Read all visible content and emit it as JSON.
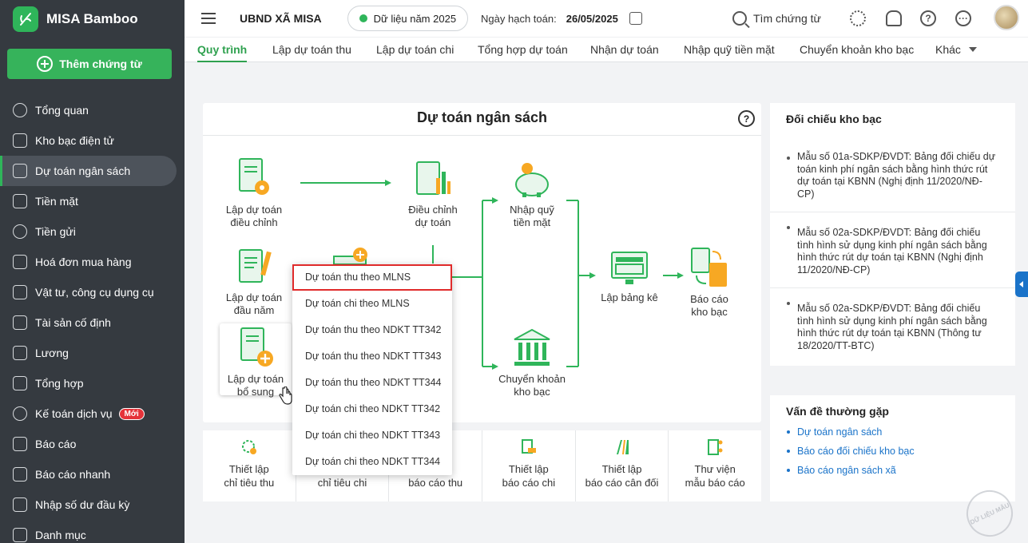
{
  "brand": {
    "name": "MISA Bamboo"
  },
  "sidebar": {
    "add_button": "Thêm chứng từ",
    "items": [
      {
        "label": "Tổng quan"
      },
      {
        "label": "Kho bạc điện tử"
      },
      {
        "label": "Dự toán ngân sách",
        "active": true
      },
      {
        "label": "Tiền mặt"
      },
      {
        "label": "Tiền gửi"
      },
      {
        "label": "Hoá đơn mua hàng"
      },
      {
        "label": "Vật tư, công cụ dụng cụ"
      },
      {
        "label": "Tài sản cố định"
      },
      {
        "label": "Lương"
      },
      {
        "label": "Tổng hợp"
      },
      {
        "label": "Kế toán dịch vụ",
        "badge": "Mới"
      },
      {
        "label": "Báo cáo"
      },
      {
        "label": "Báo cáo nhanh"
      },
      {
        "label": "Nhập số dư đầu kỳ"
      },
      {
        "label": "Danh mục"
      }
    ]
  },
  "topbar": {
    "org": "UBND XÃ MISA",
    "year": "Dữ liệu năm 2025",
    "date_label": "Ngày hạch toán:",
    "date_value": "26/05/2025",
    "search": "Tìm chứng từ"
  },
  "tabs": [
    {
      "label": "Quy trình",
      "active": true
    },
    {
      "label": "Lập dự toán thu"
    },
    {
      "label": "Lập dự toán chi"
    },
    {
      "label": "Tổng hợp dự toán"
    },
    {
      "label": "Nhận dự toán"
    },
    {
      "label": "Nhập quỹ tiền mặt"
    },
    {
      "label": "Chuyển khoản kho bạc"
    },
    {
      "label": "Khác"
    }
  ],
  "process": {
    "title": "Dự toán ngân sách",
    "help": "?",
    "nodes": {
      "lap_dieu_chinh": [
        "Lập dự toán",
        "điều chỉnh"
      ],
      "dieu_chinh": [
        "Điều chỉnh",
        "dự toán"
      ],
      "nhap_quy": [
        "Nhập quỹ",
        "tiền mặt"
      ],
      "lap_dau_nam": [
        "Lập dự toán",
        "đầu năm"
      ],
      "lap_bo_sung": [
        "Lập dự toán",
        "bổ sung"
      ],
      "lap_bang_ke": [
        "Lập bảng kê"
      ],
      "bao_cao_kho_bac": [
        "Báo cáo",
        "kho bạc"
      ],
      "chuyen_khoan": [
        "Chuyển khoản",
        "kho bạc"
      ]
    }
  },
  "dropdown": [
    "Dự toán thu theo MLNS",
    "Dự toán chi theo MLNS",
    "Dự toán thu theo NDKT TT342",
    "Dự toán thu theo NDKT TT343",
    "Dự toán thu theo NDKT TT344",
    "Dự toán chi theo NDKT TT342",
    "Dự toán chi theo NDKT TT343",
    "Dự toán chi theo NDKT TT344"
  ],
  "settings": [
    [
      "Thiết lập",
      "chỉ tiêu thu"
    ],
    [
      "",
      "chỉ tiêu chi"
    ],
    [
      "",
      "báo cáo thu"
    ],
    [
      "Thiết lập",
      "báo cáo chi"
    ],
    [
      "Thiết lập",
      "báo cáo cân đối"
    ],
    [
      "Thư viện",
      "mẫu báo cáo"
    ]
  ],
  "reconcile": {
    "title": "Đối chiếu kho bạc",
    "items": [
      "Mẫu số 01a-SDKP/ĐVDT: Bảng đối chiếu dự toán kinh phí ngân sách bằng hình thức rút dự toán tại KBNN (Nghị định 11/2020/NĐ-CP)",
      "Mẫu số 02a-SDKP/ĐVDT: Bảng đối chiếu tình hình sử dụng kinh phí ngân sách bằng hình thức rút dự toán tại KBNN (Nghị định 11/2020/NĐ-CP)",
      "Mẫu số 02a-SDKP/ĐVDT: Bảng đối chiếu tình hình sử dụng kinh phí ngân sách bằng hình thức rút dự toán tại KBNN (Thông tư 18/2020/TT-BTC)"
    ]
  },
  "faq": {
    "title": "Vấn đề thường gặp",
    "links": [
      "Dự toán ngân sách",
      "Báo cáo đối chiếu kho bạc",
      "Báo cáo ngân sách xã"
    ]
  },
  "watermark": "DỮ LIỆU MẪU",
  "colors": {
    "accent": "#2fb55a",
    "sidebar": "#353a40",
    "link": "#1a73c9",
    "highlight": "#e02b2b"
  }
}
